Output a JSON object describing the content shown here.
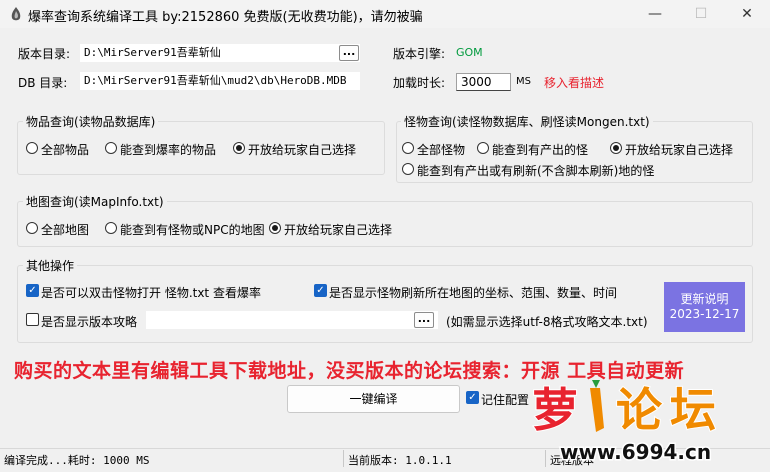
{
  "window": {
    "title": "爆率查询系统编译工具 by:2152860 免费版(无收费功能)，请勿被骗",
    "controls": {
      "minimize": "—",
      "maximize": "☐",
      "close": "✕"
    }
  },
  "paths": {
    "version_dir_label": "版本目录:",
    "version_dir_value": "D:\\MirServer91吾辈斩仙",
    "db_dir_label": "DB  目录:",
    "db_dir_value": "D:\\MirServer91吾辈斩仙\\mud2\\db\\HeroDB.MDB",
    "browse_label": "..."
  },
  "engine": {
    "label": "版本引擎:",
    "value": "GOM",
    "value_color": "#009a3d"
  },
  "load_time": {
    "label": "加载时长:",
    "value": "3000",
    "unit": "MS",
    "hover_hint": "移入看描述",
    "hint_color": "#e8232f"
  },
  "item_query": {
    "legend": "物品查询(读物品数据库)",
    "options": [
      "全部物品",
      "能查到爆率的物品",
      "开放给玩家自己选择"
    ],
    "selected": 2
  },
  "monster_query": {
    "legend": "怪物查询(读怪物数据库、刷怪读Mongen.txt)",
    "options": [
      "全部怪物",
      "能查到有产出的怪",
      "开放给玩家自己选择",
      "能查到有产出或有刷新(不含脚本刷新)地的怪"
    ],
    "selected": 2
  },
  "map_query": {
    "legend": "地图查询(读MapInfo.txt)",
    "options": [
      "全部地图",
      "能查到有怪物或NPC的地图",
      "开放给玩家自己选择"
    ],
    "selected": 2
  },
  "other_ops": {
    "legend": "其他操作",
    "dblclick_label": "是否可以双击怪物打开 怪物.txt 查看爆率",
    "dblclick_checked": true,
    "show_refresh_label": "是否显示怪物刷新所在地图的坐标、范围、数量、时间",
    "show_refresh_checked": true,
    "show_guide_label": "是否显示版本攻略",
    "show_guide_checked": false,
    "guide_path": "",
    "guide_hint": "(如需显示选择utf-8格式攻略文本.txt)",
    "update_title": "更新说明",
    "update_date": "2023-12-17",
    "update_color": "#7b73e2"
  },
  "banner": {
    "text": "购买的文本里有编辑工具下载地址，没买版本的论坛搜索：开源  工具自动更新",
    "color": "#e8232f"
  },
  "actions": {
    "compile_label": "一键编译",
    "remember_label": "记住配置",
    "remember_checked": true
  },
  "status": {
    "left": "编译完成...耗时: 1000 MS",
    "current_version": "当前版本: 1.0.1.1",
    "remote_version": "远程版本"
  },
  "watermark": {
    "site": "www.6994.cn",
    "brand_colors": [
      "#e8232f",
      "#f08a00",
      "#2a9d3c"
    ]
  }
}
